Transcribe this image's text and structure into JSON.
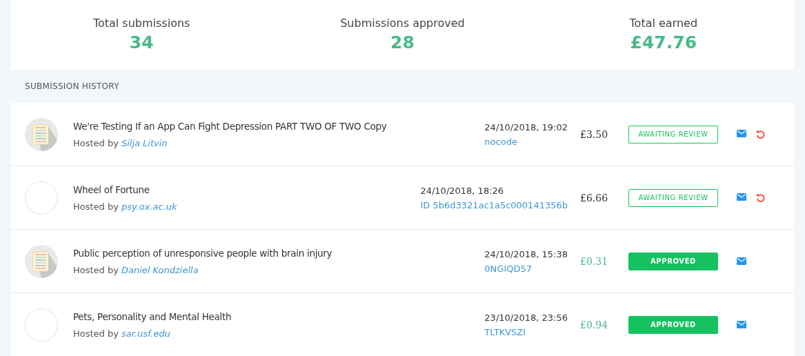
{
  "stats": [
    {
      "label": "Total submissions",
      "value": "34"
    },
    {
      "label": "Submissions approved",
      "value": "28"
    },
    {
      "label": "Total earned",
      "value": "£47.76"
    }
  ],
  "history": {
    "heading": "SUBMISSION HISTORY",
    "rows": [
      {
        "avatar": {
          "kind": "document"
        },
        "title": "We're Testing If an App Can Fight Depression PART TWO OF TWO Copy",
        "hosted_prefix": "Hosted by",
        "host": "Silja Litvin",
        "date": "24/10/2018, 19:02",
        "code": "nocode",
        "amount": "£3.50",
        "status": {
          "kind": "awaiting",
          "label": "AWAITING REVIEW"
        },
        "actions": [
          {
            "kind": "email"
          },
          {
            "kind": "undo"
          }
        ]
      },
      {
        "avatar": {
          "kind": "empty"
        },
        "title": "Wheel of Fortune",
        "hosted_prefix": "Hosted by",
        "host": "psy.ox.ac.uk",
        "date": "24/10/2018, 18:26",
        "code": "ID 5b6d3321ac1a5c000141356b",
        "amount": "£6.66",
        "status": {
          "kind": "awaiting",
          "label": "AWAITING REVIEW"
        },
        "actions": [
          {
            "kind": "email"
          },
          {
            "kind": "undo"
          }
        ]
      },
      {
        "avatar": {
          "kind": "document"
        },
        "title": "Public perception of unresponsive people with brain injury",
        "hosted_prefix": "Hosted by",
        "host": "Daniel Kondziella",
        "date": "24/10/2018, 15:38",
        "code": "0NGIQD57",
        "amount": "£0.31",
        "status": {
          "kind": "approved",
          "label": "APPROVED"
        },
        "actions": [
          {
            "kind": "email"
          }
        ]
      },
      {
        "avatar": {
          "kind": "empty"
        },
        "title": "Pets, Personality and Mental Health",
        "hosted_prefix": "Hosted by",
        "host": "sar.usf.edu",
        "date": "23/10/2018, 23:56",
        "code": "TLTKVSZI",
        "amount": "£0.94",
        "status": {
          "kind": "approved",
          "label": "APPROVED"
        },
        "actions": [
          {
            "kind": "email"
          }
        ]
      }
    ]
  }
}
